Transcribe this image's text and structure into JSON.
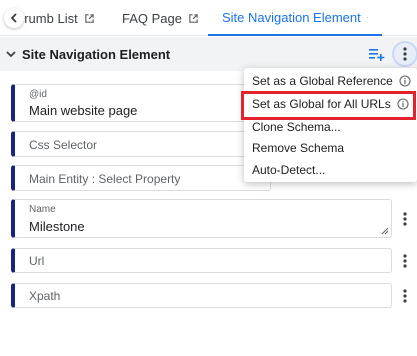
{
  "tabs": [
    {
      "label": "e Crumb List"
    },
    {
      "label": "FAQ Page"
    },
    {
      "label": "Site Navigation Element"
    }
  ],
  "section": {
    "title": "Site Navigation Element"
  },
  "fields": {
    "id": {
      "label": "@id",
      "value": "Main website page"
    },
    "css_selector": {
      "placeholder": "Css Selector"
    },
    "main_entity": {
      "placeholder": "Main Entity : Select Property"
    },
    "name": {
      "label": "Name",
      "value": "Milestone"
    },
    "url": {
      "placeholder": "Url"
    },
    "xpath": {
      "placeholder": "Xpath"
    }
  },
  "menu": {
    "items": [
      {
        "label": "Set as a Global Reference"
      },
      {
        "label": "Set as Global for All URLs"
      },
      {
        "label": "Clone Schema..."
      },
      {
        "label": "Remove Schema"
      },
      {
        "label": "Auto-Detect..."
      }
    ]
  },
  "colors": {
    "accent": "#1a73e8",
    "field_border_left": "#1a237e",
    "highlight": "#e3222b"
  }
}
